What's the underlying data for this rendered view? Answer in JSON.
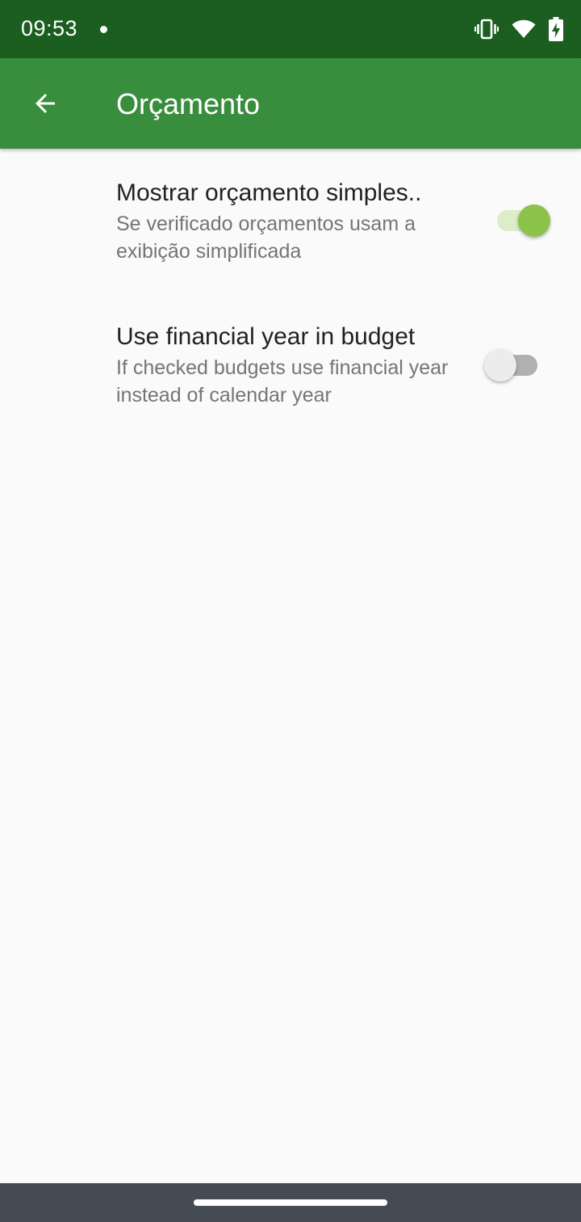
{
  "status_bar": {
    "time": "09:53",
    "icons": [
      "notification-dot",
      "vibrate-icon",
      "wifi-icon",
      "battery-charging-icon"
    ]
  },
  "app_bar": {
    "back_icon": "arrow-back-icon",
    "title": "Orçamento",
    "color": "#388e3c",
    "status_color": "#1b5e20"
  },
  "preferences": [
    {
      "title": "Mostrar orçamento simples..",
      "summary": "Se verificado orçamentos usam a exibição simplificada",
      "checked": true
    },
    {
      "title": "Use financial year in budget",
      "summary": "If checked budgets use financial year instead of calendar year",
      "checked": false
    }
  ],
  "colors": {
    "switch_on_thumb": "#8bc34a",
    "switch_on_track": "#dcedc8",
    "switch_off_thumb": "#ececec",
    "switch_off_track": "#b0b0b0",
    "background": "#fafafa",
    "nav_bar": "#444b53"
  }
}
